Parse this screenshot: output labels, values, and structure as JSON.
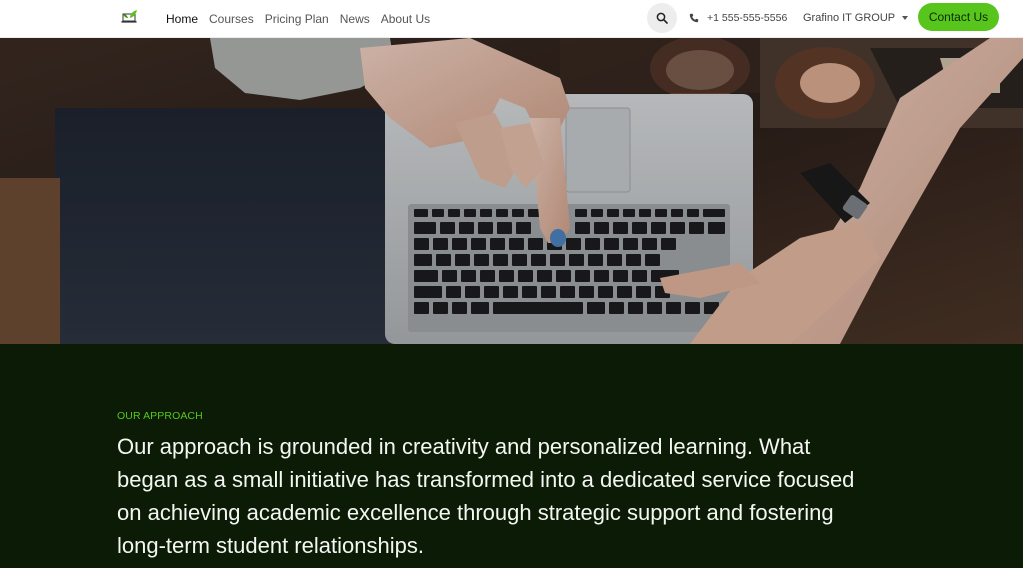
{
  "nav": {
    "logo_icon": "laptop-leaf-logo",
    "links": [
      {
        "label": "Home",
        "active": true
      },
      {
        "label": "Courses",
        "active": false
      },
      {
        "label": "Pricing Plan",
        "active": false
      },
      {
        "label": "News",
        "active": false
      },
      {
        "label": "About Us",
        "active": false
      }
    ],
    "search_icon": "search-icon",
    "phone_icon": "phone-icon",
    "phone": "+1 555-555-5556",
    "company": "Grafino IT GROUP",
    "contact_label": "Contact Us"
  },
  "hero": {
    "image": "hands-pointing-at-laptop-keyboard"
  },
  "approach": {
    "eyebrow": "OUR APPROACH",
    "text": "Our approach is grounded in creativity and personalized learning. What began as a small initiative has transformed into a dedicated service focused on achieving academic excellence through strategic support and fostering long-term student relationships."
  },
  "colors": {
    "accent": "#57c51b",
    "section_bg": "#0c1b06",
    "eyebrow": "#56c61c",
    "text_light": "#f4f6f2"
  }
}
